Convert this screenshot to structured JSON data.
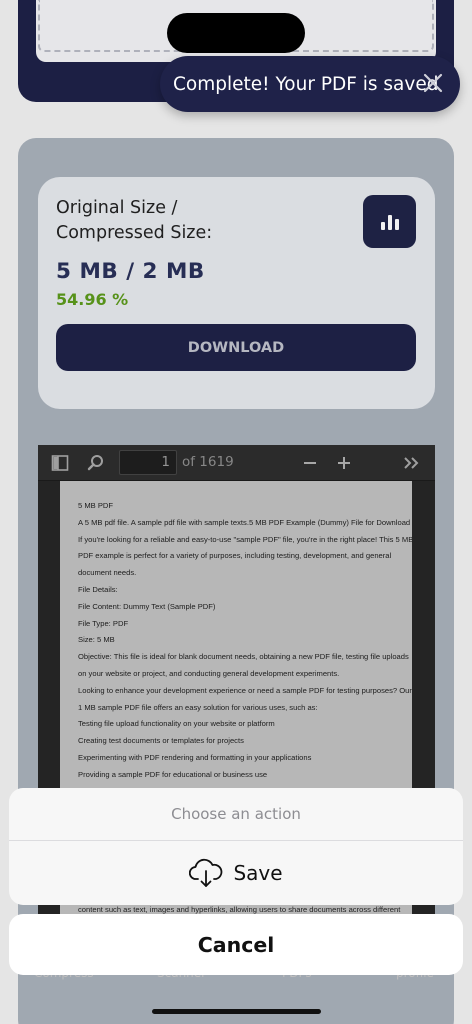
{
  "toast": {
    "message": "Complete! Your PDF is saved"
  },
  "result": {
    "size_label": "Original Size / Compressed Size:",
    "size_value": "5 MB / 2 MB",
    "percent": "54.96 %",
    "download_label": "DOWNLOAD"
  },
  "viewer": {
    "page_number": "1",
    "page_count": "of 1619",
    "lines": [
      "5 MB PDF",
      "A 5 MB pdf file. A sample pdf file with sample texts.5 MB PDF Example (Dummy) File for Download",
      "If you're looking for a reliable and easy-to-use \"sample PDF\" file, you're in the right place! This 5 MB",
      "PDF example is perfect for a variety of purposes, including testing, development, and general",
      "document needs.",
      "File Details:",
      "File Content: Dummy Text (Sample PDF)",
      "File Type: PDF",
      "Size: 5 MB",
      "Objective: This file is ideal for blank document needs, obtaining a new PDF file, testing file uploads",
      "on your website or project, and conducting general development experiments.",
      "Looking to enhance your development experience or need a sample PDF for testing purposes? Our",
      "1 MB sample PDF file offers an easy solution for various uses, such as:",
      "Testing file upload functionality on your website or platform",
      "Creating test documents or templates for projects",
      "Experimenting with PDF rendering and formatting in your applications",
      "Providing a sample PDF for educational or business use"
    ],
    "bottom_line": "content such as text, images and hyperlinks, allowing users to share documents across different"
  },
  "bottom_nav": [
    "Compress",
    "Scanner",
    "PDFs",
    "profile"
  ],
  "action_sheet": {
    "title": "Choose an action",
    "save_label": "Save",
    "cancel_label": "Cancel"
  },
  "colors": {
    "brand_navy": "#1f2248",
    "accent_green": "#5c9a1c"
  }
}
